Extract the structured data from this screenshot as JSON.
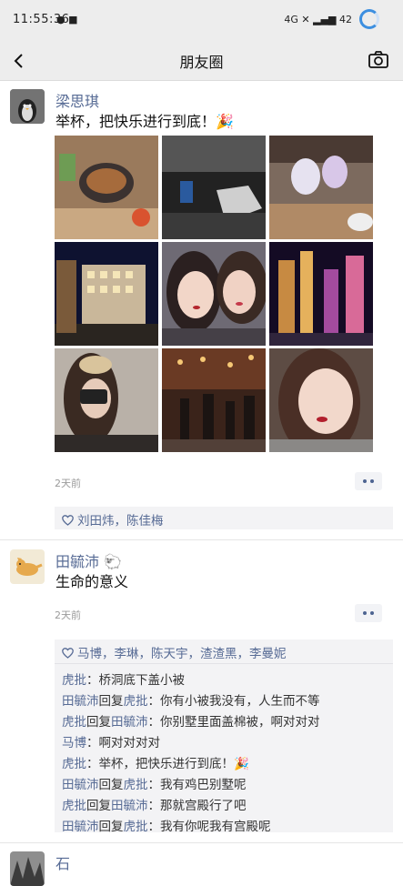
{
  "status_bar": {
    "time": "11:55:36",
    "network": "4G",
    "signal": "4G",
    "battery": "42"
  },
  "nav": {
    "title": "朋友圈"
  },
  "posts": [
    {
      "author": "梁思琪",
      "text": "举杯，把快乐进行到底！🎉",
      "time": "2天前",
      "likes": "刘田炜，陈佳梅",
      "photos": 9
    },
    {
      "author": "田毓沛 🐑",
      "text": "生命的意义",
      "time": "2天前",
      "likes": "马博，李琳，陈天宇，渣渣黑，李曼妮",
      "comments": [
        {
          "from": "虎批",
          "to": "",
          "text": "桥洞底下盖小被"
        },
        {
          "from": "田毓沛",
          "to": "虎批",
          "text": "你有小被我没有，人生而不等"
        },
        {
          "from": "虎批",
          "to": "田毓沛",
          "text": "你别墅里面盖棉被，啊对对对"
        },
        {
          "from": "马博",
          "to": "",
          "text": "啊对对对对"
        },
        {
          "from": "虎批",
          "to": "",
          "text": "举杯，把快乐进行到底！🎉"
        },
        {
          "from": "田毓沛",
          "to": "虎批",
          "text": "我有鸡巴别墅呢"
        },
        {
          "from": "虎批",
          "to": "田毓沛",
          "text": "那就宫殿行了吧"
        },
        {
          "from": "田毓沛",
          "to": "虎批",
          "text": "我有你呢我有宫殿呢"
        }
      ]
    },
    {
      "author": "石"
    }
  ],
  "labels": {
    "reply": "回复",
    "colon": "："
  },
  "colors": {
    "link": "#576b95",
    "bar": "#ededed",
    "like_bg": "#f3f3f5"
  }
}
